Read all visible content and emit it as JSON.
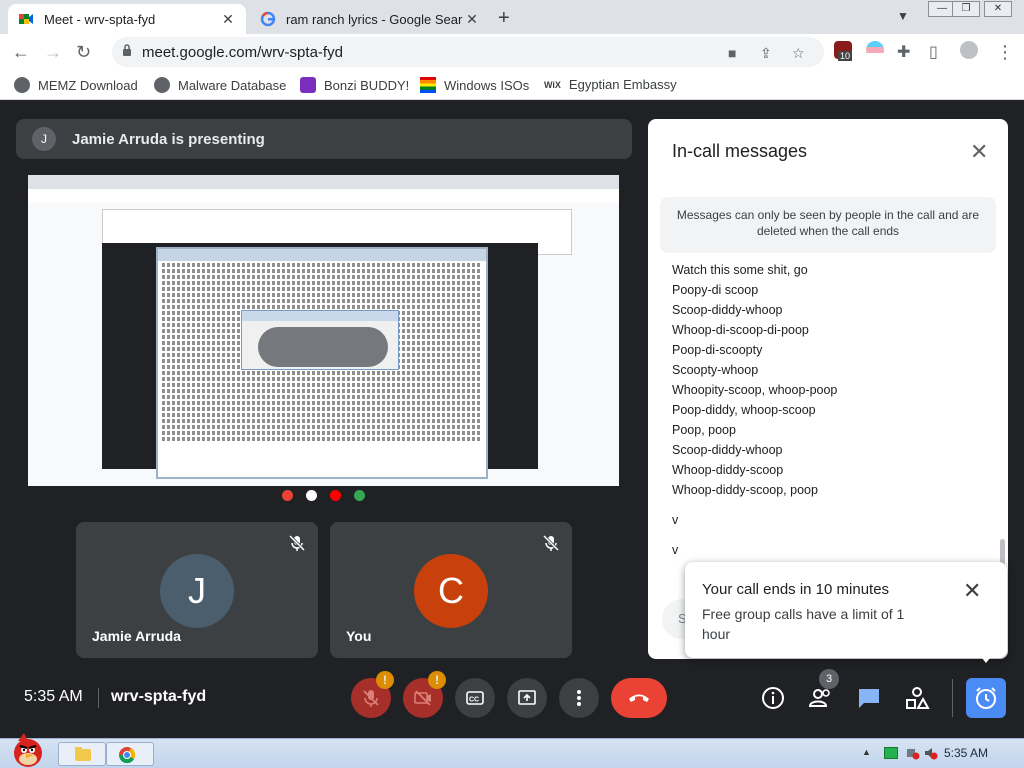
{
  "browser": {
    "tabs": [
      {
        "title": "Meet - wrv-spta-fyd",
        "active": true
      },
      {
        "title": "ram ranch lyrics - Google Sear",
        "active": false
      }
    ],
    "url": "meet.google.com/wrv-spta-fyd",
    "extension_badge": "10",
    "bookmarks": [
      "MEMZ Download",
      "Malware Database",
      "Bonzi BUDDY!",
      "Windows ISOs",
      "Egyptian Embassy"
    ]
  },
  "meet": {
    "presenter_initial": "J",
    "presenting_text": "Jamie Arruda is presenting",
    "participants": [
      {
        "initial": "J",
        "name": "Jamie Arruda",
        "color": "#4a5e6d"
      },
      {
        "initial": "C",
        "name": "You",
        "color": "#c8410d"
      }
    ],
    "time": "5:35 AM",
    "meeting_code": "wrv-spta-fyd",
    "people_count": "3",
    "warn_symbol": "!"
  },
  "messages_panel": {
    "title": "In-call messages",
    "notice": "Messages can only be seen by people in the call and are deleted when the call ends",
    "messages": [
      "Watch this some shit, go",
      "Poopy-di scoop",
      "Scoop-diddy-whoop",
      "Whoop-di-scoop-di-poop",
      "Poop-di-scoopty",
      "Scoopty-whoop",
      "Whoopity-scoop, whoop-poop",
      "Poop-diddy, whoop-scoop",
      "Poop, poop",
      "Scoop-diddy-whoop",
      "Whoop-diddy-scoop",
      "Whoop-diddy-scoop, poop",
      "v",
      "v"
    ],
    "input_partial": "S"
  },
  "toast": {
    "title": "Your call ends in 10 minutes",
    "body": "Free group calls have a limit of 1 hour"
  },
  "taskbar": {
    "time": "5:35 AM"
  },
  "colors": {
    "meet_bg": "#202124",
    "hangup": "#ea4335",
    "accent_blue": "#4b8bf4",
    "warning": "#f29900"
  }
}
